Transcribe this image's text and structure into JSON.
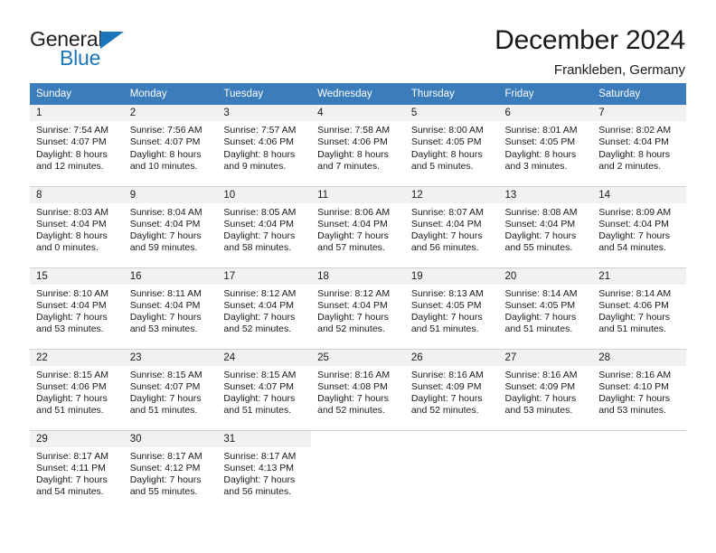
{
  "brand": {
    "name_part1": "General",
    "name_part2": "Blue",
    "triangle_color": "#1b75bb"
  },
  "header": {
    "title": "December 2024",
    "subtitle": "Frankleben, Germany",
    "accent_color": "#3b7cba"
  },
  "weekday_headers": [
    "Sunday",
    "Monday",
    "Tuesday",
    "Wednesday",
    "Thursday",
    "Friday",
    "Saturday"
  ],
  "labels": {
    "sunrise_prefix": "Sunrise:",
    "sunset_prefix": "Sunset:",
    "daylight_prefix": "Daylight:"
  },
  "weeks": [
    [
      {
        "day": "1",
        "sunrise": "Sunrise: 7:54 AM",
        "sunset": "Sunset: 4:07 PM",
        "daylight_line1": "Daylight: 8 hours",
        "daylight_line2": "and 12 minutes."
      },
      {
        "day": "2",
        "sunrise": "Sunrise: 7:56 AM",
        "sunset": "Sunset: 4:07 PM",
        "daylight_line1": "Daylight: 8 hours",
        "daylight_line2": "and 10 minutes."
      },
      {
        "day": "3",
        "sunrise": "Sunrise: 7:57 AM",
        "sunset": "Sunset: 4:06 PM",
        "daylight_line1": "Daylight: 8 hours",
        "daylight_line2": "and 9 minutes."
      },
      {
        "day": "4",
        "sunrise": "Sunrise: 7:58 AM",
        "sunset": "Sunset: 4:06 PM",
        "daylight_line1": "Daylight: 8 hours",
        "daylight_line2": "and 7 minutes."
      },
      {
        "day": "5",
        "sunrise": "Sunrise: 8:00 AM",
        "sunset": "Sunset: 4:05 PM",
        "daylight_line1": "Daylight: 8 hours",
        "daylight_line2": "and 5 minutes."
      },
      {
        "day": "6",
        "sunrise": "Sunrise: 8:01 AM",
        "sunset": "Sunset: 4:05 PM",
        "daylight_line1": "Daylight: 8 hours",
        "daylight_line2": "and 3 minutes."
      },
      {
        "day": "7",
        "sunrise": "Sunrise: 8:02 AM",
        "sunset": "Sunset: 4:04 PM",
        "daylight_line1": "Daylight: 8 hours",
        "daylight_line2": "and 2 minutes."
      }
    ],
    [
      {
        "day": "8",
        "sunrise": "Sunrise: 8:03 AM",
        "sunset": "Sunset: 4:04 PM",
        "daylight_line1": "Daylight: 8 hours",
        "daylight_line2": "and 0 minutes."
      },
      {
        "day": "9",
        "sunrise": "Sunrise: 8:04 AM",
        "sunset": "Sunset: 4:04 PM",
        "daylight_line1": "Daylight: 7 hours",
        "daylight_line2": "and 59 minutes."
      },
      {
        "day": "10",
        "sunrise": "Sunrise: 8:05 AM",
        "sunset": "Sunset: 4:04 PM",
        "daylight_line1": "Daylight: 7 hours",
        "daylight_line2": "and 58 minutes."
      },
      {
        "day": "11",
        "sunrise": "Sunrise: 8:06 AM",
        "sunset": "Sunset: 4:04 PM",
        "daylight_line1": "Daylight: 7 hours",
        "daylight_line2": "and 57 minutes."
      },
      {
        "day": "12",
        "sunrise": "Sunrise: 8:07 AM",
        "sunset": "Sunset: 4:04 PM",
        "daylight_line1": "Daylight: 7 hours",
        "daylight_line2": "and 56 minutes."
      },
      {
        "day": "13",
        "sunrise": "Sunrise: 8:08 AM",
        "sunset": "Sunset: 4:04 PM",
        "daylight_line1": "Daylight: 7 hours",
        "daylight_line2": "and 55 minutes."
      },
      {
        "day": "14",
        "sunrise": "Sunrise: 8:09 AM",
        "sunset": "Sunset: 4:04 PM",
        "daylight_line1": "Daylight: 7 hours",
        "daylight_line2": "and 54 minutes."
      }
    ],
    [
      {
        "day": "15",
        "sunrise": "Sunrise: 8:10 AM",
        "sunset": "Sunset: 4:04 PM",
        "daylight_line1": "Daylight: 7 hours",
        "daylight_line2": "and 53 minutes."
      },
      {
        "day": "16",
        "sunrise": "Sunrise: 8:11 AM",
        "sunset": "Sunset: 4:04 PM",
        "daylight_line1": "Daylight: 7 hours",
        "daylight_line2": "and 53 minutes."
      },
      {
        "day": "17",
        "sunrise": "Sunrise: 8:12 AM",
        "sunset": "Sunset: 4:04 PM",
        "daylight_line1": "Daylight: 7 hours",
        "daylight_line2": "and 52 minutes."
      },
      {
        "day": "18",
        "sunrise": "Sunrise: 8:12 AM",
        "sunset": "Sunset: 4:04 PM",
        "daylight_line1": "Daylight: 7 hours",
        "daylight_line2": "and 52 minutes."
      },
      {
        "day": "19",
        "sunrise": "Sunrise: 8:13 AM",
        "sunset": "Sunset: 4:05 PM",
        "daylight_line1": "Daylight: 7 hours",
        "daylight_line2": "and 51 minutes."
      },
      {
        "day": "20",
        "sunrise": "Sunrise: 8:14 AM",
        "sunset": "Sunset: 4:05 PM",
        "daylight_line1": "Daylight: 7 hours",
        "daylight_line2": "and 51 minutes."
      },
      {
        "day": "21",
        "sunrise": "Sunrise: 8:14 AM",
        "sunset": "Sunset: 4:06 PM",
        "daylight_line1": "Daylight: 7 hours",
        "daylight_line2": "and 51 minutes."
      }
    ],
    [
      {
        "day": "22",
        "sunrise": "Sunrise: 8:15 AM",
        "sunset": "Sunset: 4:06 PM",
        "daylight_line1": "Daylight: 7 hours",
        "daylight_line2": "and 51 minutes."
      },
      {
        "day": "23",
        "sunrise": "Sunrise: 8:15 AM",
        "sunset": "Sunset: 4:07 PM",
        "daylight_line1": "Daylight: 7 hours",
        "daylight_line2": "and 51 minutes."
      },
      {
        "day": "24",
        "sunrise": "Sunrise: 8:15 AM",
        "sunset": "Sunset: 4:07 PM",
        "daylight_line1": "Daylight: 7 hours",
        "daylight_line2": "and 51 minutes."
      },
      {
        "day": "25",
        "sunrise": "Sunrise: 8:16 AM",
        "sunset": "Sunset: 4:08 PM",
        "daylight_line1": "Daylight: 7 hours",
        "daylight_line2": "and 52 minutes."
      },
      {
        "day": "26",
        "sunrise": "Sunrise: 8:16 AM",
        "sunset": "Sunset: 4:09 PM",
        "daylight_line1": "Daylight: 7 hours",
        "daylight_line2": "and 52 minutes."
      },
      {
        "day": "27",
        "sunrise": "Sunrise: 8:16 AM",
        "sunset": "Sunset: 4:09 PM",
        "daylight_line1": "Daylight: 7 hours",
        "daylight_line2": "and 53 minutes."
      },
      {
        "day": "28",
        "sunrise": "Sunrise: 8:16 AM",
        "sunset": "Sunset: 4:10 PM",
        "daylight_line1": "Daylight: 7 hours",
        "daylight_line2": "and 53 minutes."
      }
    ],
    [
      {
        "day": "29",
        "sunrise": "Sunrise: 8:17 AM",
        "sunset": "Sunset: 4:11 PM",
        "daylight_line1": "Daylight: 7 hours",
        "daylight_line2": "and 54 minutes."
      },
      {
        "day": "30",
        "sunrise": "Sunrise: 8:17 AM",
        "sunset": "Sunset: 4:12 PM",
        "daylight_line1": "Daylight: 7 hours",
        "daylight_line2": "and 55 minutes."
      },
      {
        "day": "31",
        "sunrise": "Sunrise: 8:17 AM",
        "sunset": "Sunset: 4:13 PM",
        "daylight_line1": "Daylight: 7 hours",
        "daylight_line2": "and 56 minutes."
      },
      {
        "day": "",
        "sunrise": "",
        "sunset": "",
        "daylight_line1": "",
        "daylight_line2": ""
      },
      {
        "day": "",
        "sunrise": "",
        "sunset": "",
        "daylight_line1": "",
        "daylight_line2": ""
      },
      {
        "day": "",
        "sunrise": "",
        "sunset": "",
        "daylight_line1": "",
        "daylight_line2": ""
      },
      {
        "day": "",
        "sunrise": "",
        "sunset": "",
        "daylight_line1": "",
        "daylight_line2": ""
      }
    ]
  ]
}
